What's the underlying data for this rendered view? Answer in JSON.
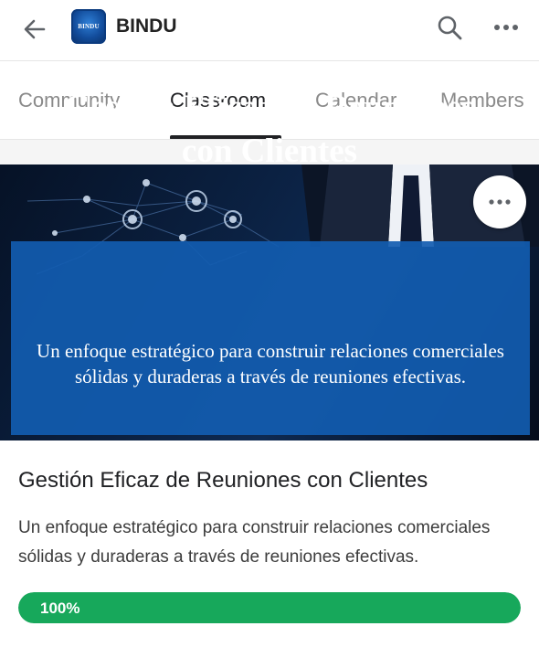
{
  "header": {
    "back_icon": "arrow-left-icon",
    "logo_text": "BINDU",
    "title": "BINDU",
    "search_icon": "search-icon",
    "more_icon": "more-horizontal-icon"
  },
  "tabs": [
    {
      "label": "Community",
      "active": false
    },
    {
      "label": "Classroom",
      "active": true
    },
    {
      "label": "Calendar",
      "active": false
    },
    {
      "label": "Members",
      "active": false
    }
  ],
  "course": {
    "banner": {
      "title_line1": "Gestión Eficaz de Reuniones",
      "title_line2": "con Clientes",
      "subtitle": "Un enfoque estratégico para construir relaciones comerciales sólidas y duraderas a través de reuniones efectivas.",
      "more_icon": "more-horizontal-icon"
    },
    "title": "Gestión Eficaz de Reuniones con Clientes",
    "description": "Un enfoque estratégico para construir relaciones comerciales sólidas y duraderas a través de reuniones efectivas.",
    "progress": 1.0,
    "progress_label": "100%"
  },
  "colors": {
    "progress_fill": "#17a85b",
    "banner_box": "#125cb0",
    "active_tab": "#202124",
    "inactive_tab": "#8a8a8a"
  }
}
